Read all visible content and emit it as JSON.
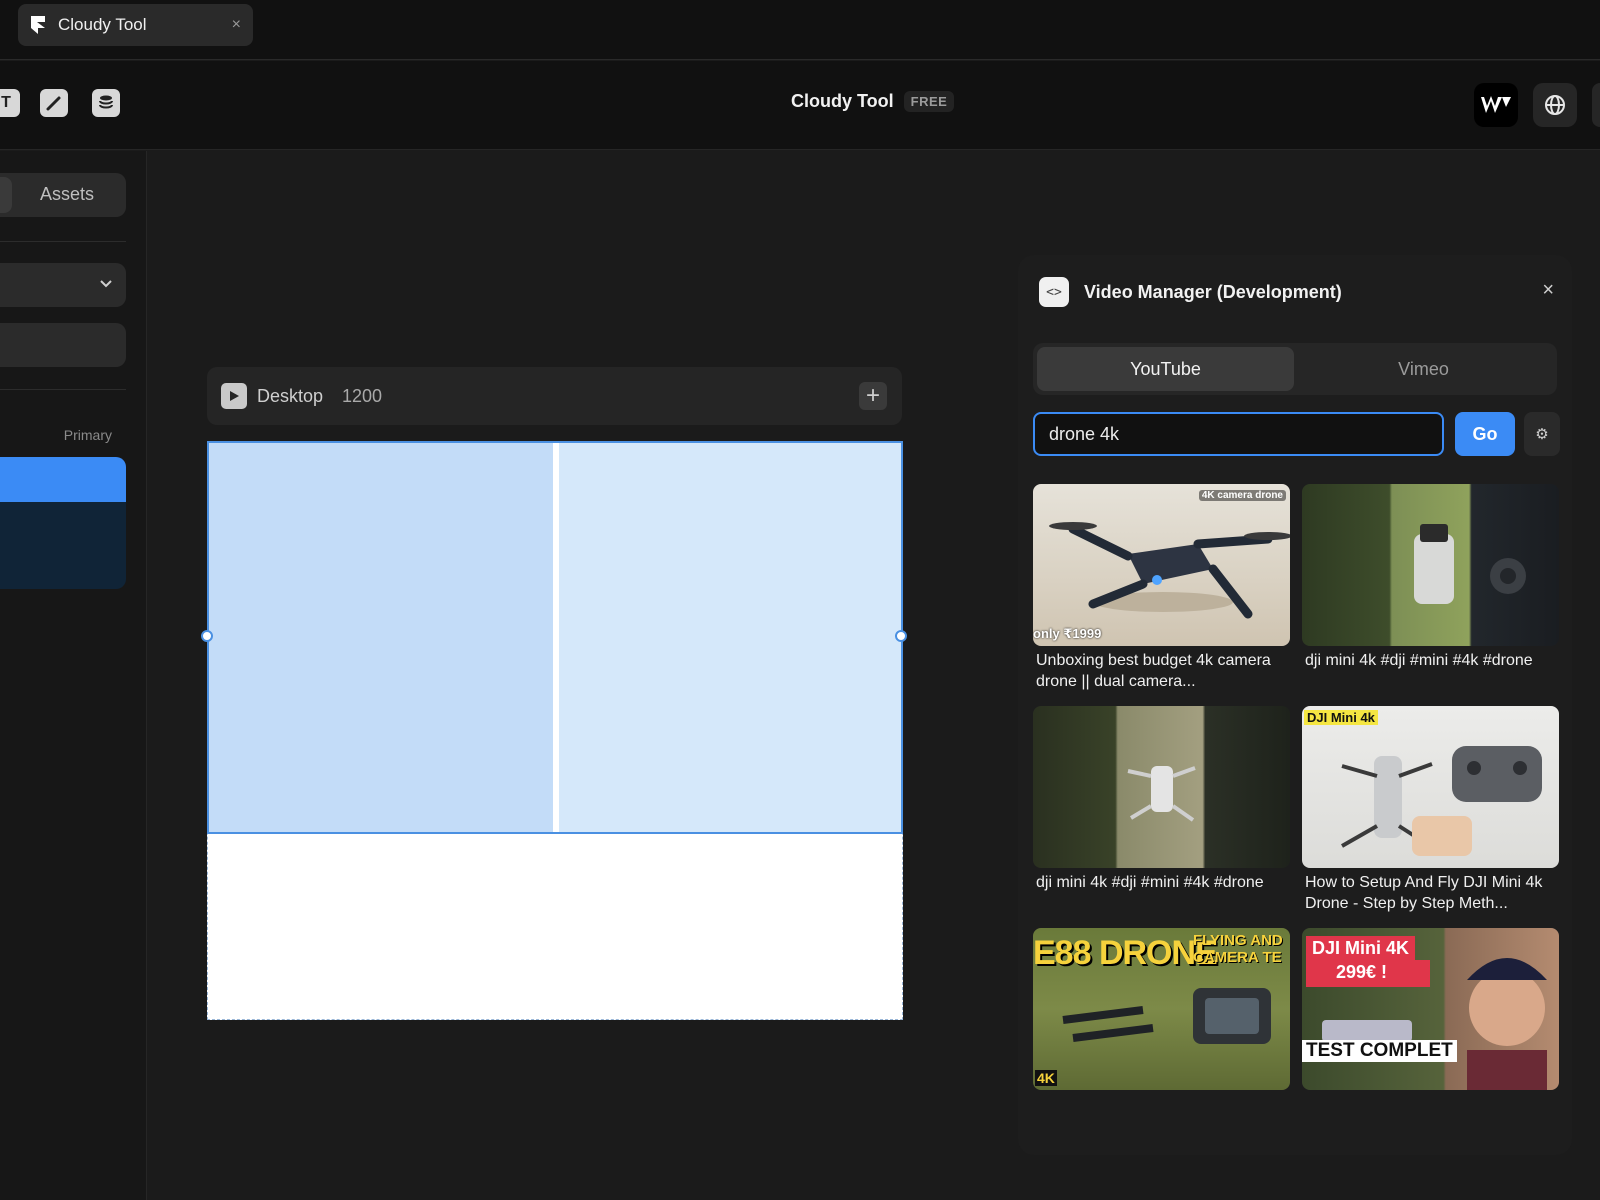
{
  "tab": {
    "title": "Cloudy Tool",
    "close": "×"
  },
  "toolbar": {
    "left_tools": [
      "text-icon",
      "pen-icon",
      "database-icon"
    ],
    "title": "Cloudy Tool",
    "plan_badge": "FREE"
  },
  "sidebar": {
    "tab_label": "Assets",
    "primary_label": "Primary"
  },
  "canvas": {
    "frame_name": "Desktop",
    "frame_width": "1200",
    "add": "+"
  },
  "panel": {
    "title": "Video Manager (Development)",
    "close": "×",
    "tabs": {
      "youtube": "YouTube",
      "vimeo": "Vimeo"
    },
    "search_value": "drone 4k",
    "go_label": "Go",
    "settings": "⚙",
    "videos": [
      {
        "title": "Unboxing best budget 4k camera drone || dual camera...",
        "overlay_top": "4K camera drone",
        "overlay_bottom": "only ₹1999"
      },
      {
        "title": "dji mini 4k #dji #mini #4k #drone"
      },
      {
        "title": "dji mini 4k #dji #mini #4k #drone"
      },
      {
        "title": "How to Setup And Fly DJI Mini 4k Drone - Step by Step Meth...",
        "overlay_top": "DJI Mini 4k"
      },
      {
        "title": "",
        "overlay_top": "E88 DRONE",
        "overlay_side": "FLYING AND CAMERA TE",
        "overlay_badge": "4K"
      },
      {
        "title": "",
        "overlay_top": "DJI Mini 4K",
        "overlay_price": "299€ !",
        "overlay_bottom": "TEST COMPLET"
      }
    ]
  },
  "colors": {
    "accent": "#3b8bf5",
    "background": "#1b1b1b",
    "panel": "#1d1d1d"
  }
}
